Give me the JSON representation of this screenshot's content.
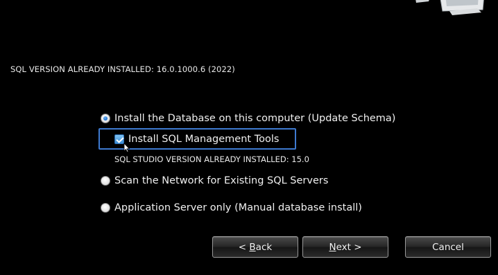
{
  "header": {
    "sql_version_label": "SQL VERSION ALREADY INSTALLED: 16.0.1000.6 (2022)"
  },
  "options": {
    "install_db": {
      "label": "Install the Database on this computer (Update Schema)",
      "selected": true
    },
    "install_tools": {
      "label": "Install SQL Management Tools",
      "checked": true
    },
    "studio_version": "SQL STUDIO VERSION ALREADY INSTALLED: 15.0",
    "scan_network": {
      "label": "Scan the Network for Existing SQL Servers",
      "selected": false
    },
    "app_server": {
      "label": "Application Server only (Manual database install)",
      "selected": false
    }
  },
  "buttons": {
    "back": {
      "prefix": "< ",
      "mnemonic": "B",
      "rest": "ack"
    },
    "next": {
      "mnemonic": "N",
      "rest": "ext >"
    },
    "cancel": "Cancel"
  },
  "colors": {
    "background": "#000000",
    "highlight_border": "#3e7ad0",
    "radio_dot": "#1a6dd0"
  }
}
